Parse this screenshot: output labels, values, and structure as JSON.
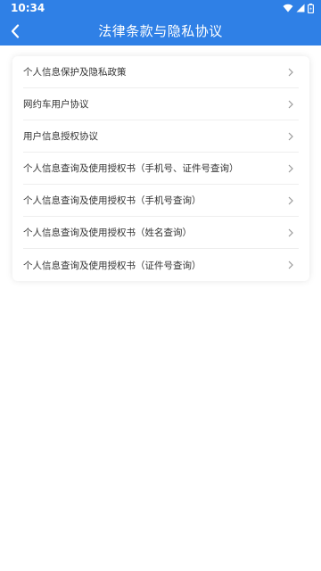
{
  "status_bar": {
    "time": "10:34",
    "icons": [
      "wifi-icon",
      "signal-icon",
      "battery-icon"
    ]
  },
  "toolbar": {
    "back_icon": "chevron-left-icon",
    "title": "法律条款与隐私协议"
  },
  "colors": {
    "header_bg": "#2f80e6",
    "row_text": "#333333",
    "chevron": "#999999",
    "divider": "#eeeeee"
  },
  "agreements": [
    {
      "label": "个人信息保护及隐私政策"
    },
    {
      "label": "网约车用户协议"
    },
    {
      "label": "用户信息授权协议"
    },
    {
      "label": "个人信息查询及使用授权书（手机号、证件号查询）"
    },
    {
      "label": "个人信息查询及使用授权书（手机号查询）"
    },
    {
      "label": "个人信息查询及使用授权书（姓名查询）"
    },
    {
      "label": "个人信息查询及使用授权书（证件号查询）"
    }
  ]
}
